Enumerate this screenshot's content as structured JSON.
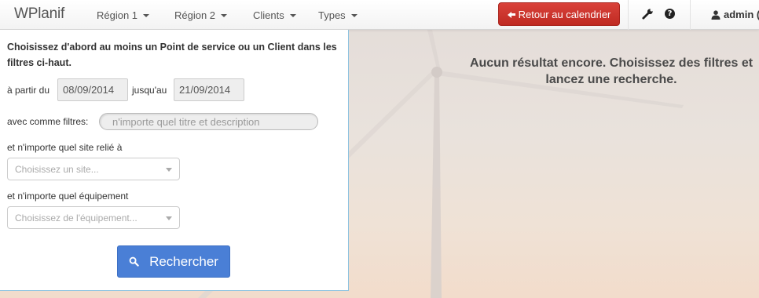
{
  "navbar": {
    "brand": "WPlanif",
    "menu": [
      {
        "label": "Région 1"
      },
      {
        "label": "Région 2"
      },
      {
        "label": "Clients"
      },
      {
        "label": "Types"
      }
    ],
    "back_button": "Retour au calendrier",
    "user": "admin (",
    "colors": {
      "back_button": "#c9302c"
    },
    "icons": [
      "wrench-icon",
      "question-icon",
      "user-icon",
      "arrow-left-icon"
    ]
  },
  "search": {
    "intro": "Choisissez d'abord au moins un Point de service ou un Client dans les filtres ci-haut.",
    "from_label": "à partir du",
    "from_value": "08/09/2014",
    "to_label": "jusqu'au",
    "to_value": "21/09/2014",
    "filters_label": "avec comme filtres:",
    "filters_placeholder": "n'importe quel titre et description",
    "site_label": "et n'importe quel site relié à",
    "site_placeholder": "Choisissez un site...",
    "equipment_label": "et n'importe quel équipement",
    "equipment_placeholder": "Choisissez de l'équipement...",
    "search_button": "Rechercher",
    "colors": {
      "search_button": "#4a7fd6"
    }
  },
  "results": {
    "message": "Aucun résultat encore. Choisissez des filtres et lancez une recherche."
  }
}
